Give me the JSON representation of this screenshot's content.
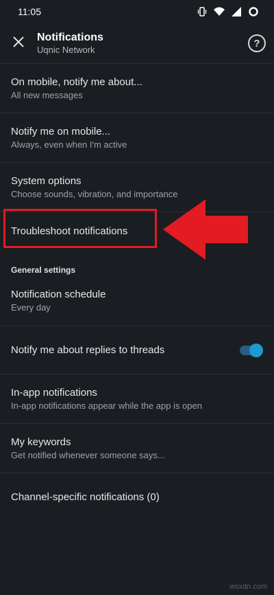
{
  "status_bar": {
    "time": "11:05",
    "icons": [
      "vibrate-icon",
      "wifi-icon",
      "signal-icon",
      "battery-ring-icon"
    ]
  },
  "header": {
    "title": "Notifications",
    "subtitle": "Uqnic Network",
    "close_icon": "close-icon",
    "help_label": "?"
  },
  "items": [
    {
      "title": "On mobile, notify me about...",
      "subtitle": "All new messages"
    },
    {
      "title": "Notify me on mobile...",
      "subtitle": "Always, even when I'm active"
    },
    {
      "title": "System options",
      "subtitle": "Choose sounds, vibration, and importance"
    },
    {
      "title": "Troubleshoot notifications",
      "subtitle": ""
    }
  ],
  "general": {
    "header": "General settings",
    "items": [
      {
        "title": "Notification schedule",
        "subtitle": "Every day"
      },
      {
        "title": "Notify me about replies to threads",
        "toggle_on": true
      },
      {
        "title": "In-app notifications",
        "subtitle": "In-app notifications appear while the app is open"
      },
      {
        "title": "My keywords",
        "subtitle": "Get notified whenever someone says..."
      },
      {
        "title": "Channel-specific notifications (0)",
        "subtitle": ""
      }
    ]
  },
  "annotation": {
    "color": "#e31b23"
  },
  "watermark": "wsxdn.com",
  "colors": {
    "background": "#1a1d21",
    "toggle_accent": "#1d9bd1"
  }
}
